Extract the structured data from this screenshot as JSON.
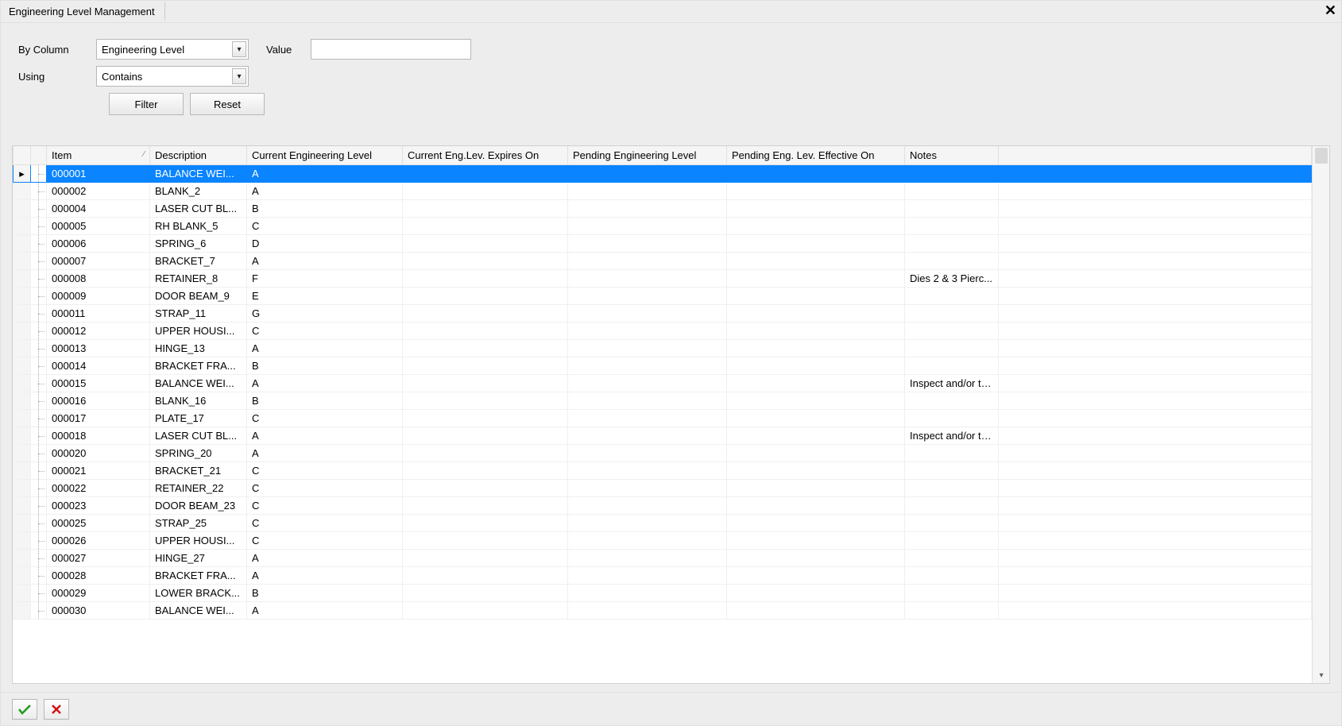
{
  "tab": {
    "title": "Engineering Level Management"
  },
  "filter": {
    "by_column_label": "By Column",
    "by_column_value": "Engineering Level",
    "value_label": "Value",
    "value_text": "",
    "using_label": "Using",
    "using_value": "Contains",
    "filter_btn": "Filter",
    "reset_btn": "Reset"
  },
  "headers": {
    "item": "Item",
    "description": "Description",
    "current_level": "Current Engineering Level",
    "current_expires": "Current Eng.Lev. Expires On",
    "pending_level": "Pending Engineering Level",
    "pending_effective": "Pending Eng. Lev. Effective On",
    "notes": "Notes"
  },
  "rows": [
    {
      "item": "000001",
      "desc": "BALANCE  WEI...",
      "curlev": "A",
      "curexp": "",
      "pendlv": "",
      "pendef": "",
      "notes": "",
      "selected": true
    },
    {
      "item": "000002",
      "desc": "BLANK_2",
      "curlev": "A",
      "curexp": "",
      "pendlv": "",
      "pendef": "",
      "notes": ""
    },
    {
      "item": "000004",
      "desc": "LASER  CUT  BL...",
      "curlev": "B",
      "curexp": "",
      "pendlv": "",
      "pendef": "",
      "notes": ""
    },
    {
      "item": "000005",
      "desc": "RH BLANK_5",
      "curlev": "C",
      "curexp": "",
      "pendlv": "",
      "pendef": "",
      "notes": ""
    },
    {
      "item": "000006",
      "desc": "SPRING_6",
      "curlev": "D",
      "curexp": "",
      "pendlv": "",
      "pendef": "",
      "notes": ""
    },
    {
      "item": "000007",
      "desc": "BRACKET_7",
      "curlev": "A",
      "curexp": "",
      "pendlv": "",
      "pendef": "",
      "notes": ""
    },
    {
      "item": "000008",
      "desc": "RETAINER_8",
      "curlev": "F",
      "curexp": "",
      "pendlv": "",
      "pendef": "",
      "notes": "Dies 2 & 3 Pierc..."
    },
    {
      "item": "000009",
      "desc": "DOOR BEAM_9",
      "curlev": "E",
      "curexp": "",
      "pendlv": "",
      "pendef": "",
      "notes": ""
    },
    {
      "item": "000011",
      "desc": "STRAP_11",
      "curlev": "G",
      "curexp": "",
      "pendlv": "",
      "pendef": "",
      "notes": ""
    },
    {
      "item": "000012",
      "desc": "UPPER  HOUSI...",
      "curlev": "C",
      "curexp": "",
      "pendlv": "",
      "pendef": "",
      "notes": ""
    },
    {
      "item": "000013",
      "desc": "HINGE_13",
      "curlev": "A",
      "curexp": "",
      "pendlv": "",
      "pendef": "",
      "notes": ""
    },
    {
      "item": "000014",
      "desc": "BRACKET  FRA...",
      "curlev": "B",
      "curexp": "",
      "pendlv": "",
      "pendef": "",
      "notes": ""
    },
    {
      "item": "000015",
      "desc": "BALANCE  WEI...",
      "curlev": "A",
      "curexp": "",
      "pendlv": "",
      "pendef": "",
      "notes": "Inspect and/or te..."
    },
    {
      "item": "000016",
      "desc": "BLANK_16",
      "curlev": "B",
      "curexp": "",
      "pendlv": "",
      "pendef": "",
      "notes": ""
    },
    {
      "item": "000017",
      "desc": "PLATE_17",
      "curlev": "C",
      "curexp": "",
      "pendlv": "",
      "pendef": "",
      "notes": ""
    },
    {
      "item": "000018",
      "desc": "LASER  CUT  BL...",
      "curlev": "A",
      "curexp": "",
      "pendlv": "",
      "pendef": "",
      "notes": "Inspect and/or te..."
    },
    {
      "item": "000020",
      "desc": "SPRING_20",
      "curlev": "A",
      "curexp": "",
      "pendlv": "",
      "pendef": "",
      "notes": ""
    },
    {
      "item": "000021",
      "desc": "BRACKET_21",
      "curlev": "C",
      "curexp": "",
      "pendlv": "",
      "pendef": "",
      "notes": ""
    },
    {
      "item": "000022",
      "desc": "RETAINER_22",
      "curlev": "C",
      "curexp": "",
      "pendlv": "",
      "pendef": "",
      "notes": ""
    },
    {
      "item": "000023",
      "desc": "DOOR BEAM_23",
      "curlev": "C",
      "curexp": "",
      "pendlv": "",
      "pendef": "",
      "notes": ""
    },
    {
      "item": "000025",
      "desc": "STRAP_25",
      "curlev": "C",
      "curexp": "",
      "pendlv": "",
      "pendef": "",
      "notes": ""
    },
    {
      "item": "000026",
      "desc": "UPPER  HOUSI...",
      "curlev": "C",
      "curexp": "",
      "pendlv": "",
      "pendef": "",
      "notes": ""
    },
    {
      "item": "000027",
      "desc": "HINGE_27",
      "curlev": "A",
      "curexp": "",
      "pendlv": "",
      "pendef": "",
      "notes": ""
    },
    {
      "item": "000028",
      "desc": "BRACKET  FRA...",
      "curlev": "A",
      "curexp": "",
      "pendlv": "",
      "pendef": "",
      "notes": ""
    },
    {
      "item": "000029",
      "desc": "LOWER  BRACK...",
      "curlev": "B",
      "curexp": "",
      "pendlv": "",
      "pendef": "",
      "notes": ""
    },
    {
      "item": "000030",
      "desc": "BALANCE  WEI...",
      "curlev": "A",
      "curexp": "",
      "pendlv": "",
      "pendef": "",
      "notes": ""
    }
  ],
  "icons": {
    "check_color": "#1e9b1e",
    "x_color": "#d21313"
  }
}
